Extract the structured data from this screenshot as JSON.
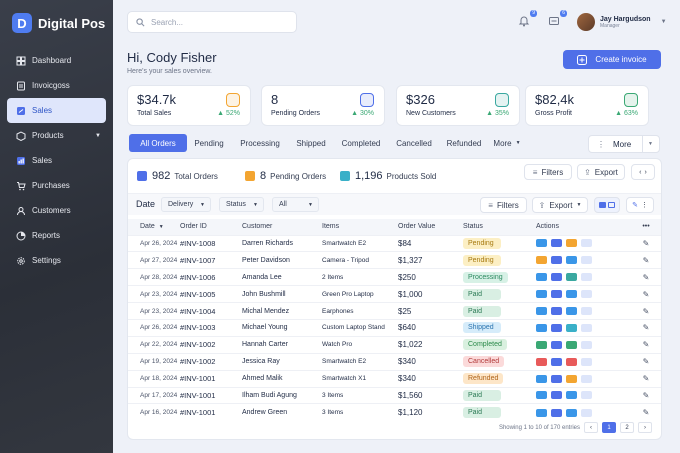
{
  "app": {
    "name": "Digital Pos",
    "logo_letter": "D"
  },
  "sidebar": {
    "items": [
      {
        "label": "Dashboard",
        "icon": "grid-icon"
      },
      {
        "label": "Invoicgoss",
        "icon": "invoice-icon"
      },
      {
        "label": "Sales",
        "icon": "sales-icon",
        "active": true
      },
      {
        "label": "Products",
        "icon": "box-icon",
        "has_caret": true
      },
      {
        "label": "Sales",
        "icon": "chart-icon"
      },
      {
        "label": "Purchases",
        "icon": "cart-icon"
      },
      {
        "label": "Customers",
        "icon": "user-icon"
      },
      {
        "label": "Reports",
        "icon": "report-icon"
      },
      {
        "label": "Settings",
        "icon": "gear-icon"
      }
    ]
  },
  "header": {
    "search_placeholder": "Search...",
    "notification_count": "9",
    "message_count": "6",
    "user_name": "Jay Hargudson",
    "user_role": "Manager"
  },
  "greeting": {
    "title": "Hi, Cody Fisher",
    "subtitle": "Here's your sales overview."
  },
  "create_button": "Create invoice",
  "stats": [
    {
      "value": "$34.7k",
      "label": "Total Sales",
      "change": "▲ 52%",
      "icon_color": "#f3a531"
    },
    {
      "value": "8",
      "label": "Pending Orders",
      "change": "▲ 30%",
      "icon_color": "#4f6fe8"
    },
    {
      "value": "$326",
      "label": "New Customers",
      "change": "▲ 35%",
      "icon_color": "#3aa8a0"
    },
    {
      "value": "$82,4k",
      "label": "Gross Profit",
      "change": "▲ 63%",
      "icon_color": "#3aa874"
    }
  ],
  "tabs": [
    "All Orders",
    "Pending",
    "Processing",
    "Shipped",
    "Completed",
    "Cancelled",
    "Refunded",
    "More"
  ],
  "more_button": "More",
  "summary": [
    {
      "count": "982",
      "label": "Total Orders",
      "color": "#4f6fe8"
    },
    {
      "count": "8",
      "label": "Pending Orders",
      "color": "#f3a531"
    },
    {
      "count": "1,196",
      "label": "Products Sold",
      "color": "#3ab0c8"
    }
  ],
  "top_buttons": {
    "filters": "Filters",
    "export": "Export"
  },
  "filter_bar": {
    "date_label": "Date",
    "delivery": "Delivery",
    "status": "Status",
    "all": "All",
    "filters": "Filters",
    "export": "Export"
  },
  "table": {
    "columns": [
      "Date",
      "Order ID",
      "Customer",
      "Items",
      "Order Value",
      "Status",
      "Actions"
    ],
    "rows": [
      {
        "date": "Apr 26, 2024",
        "id": "#INV-1008",
        "customer": "Darren Richards",
        "items": "Smartwatch E2",
        "value": "$84",
        "status": "Pending"
      },
      {
        "date": "Apr 27, 2024",
        "id": "#INV-1007",
        "customer": "Peter Davidson",
        "items": "Camera - Tripod",
        "value": "$1,327",
        "status": "Pending"
      },
      {
        "date": "Apr 28, 2024",
        "id": "#INV-1006",
        "customer": "Amanda Lee",
        "items": "2 Items",
        "value": "$250",
        "status": "Processing"
      },
      {
        "date": "Apr 23, 2024",
        "id": "#INV-1005",
        "customer": "John Bushmill",
        "items": "Green Pro Laptop",
        "value": "$1,000",
        "status": "Paid"
      },
      {
        "date": "Apr 23, 2024",
        "id": "#INV-1004",
        "customer": "Michal Mendez",
        "items": "Earphones",
        "value": "$25",
        "status": "Paid"
      },
      {
        "date": "Apr 26, 2024",
        "id": "#INV-1003",
        "customer": "Michael Young",
        "items": "Custom Laptop Stand",
        "value": "$640",
        "status": "Shipped"
      },
      {
        "date": "Apr 22, 2024",
        "id": "#INV-1002",
        "customer": "Hannah Carter",
        "items": "Watch Pro",
        "value": "$1,022",
        "status": "Completed"
      },
      {
        "date": "Apr 19, 2024",
        "id": "#INV-1002",
        "customer": "Jessica Ray",
        "items": "Smartwatch E2",
        "value": "$340",
        "status": "Cancelled"
      },
      {
        "date": "Apr 18, 2024",
        "id": "#INV-1001",
        "customer": "Ahmed Malik",
        "items": "Smartwatch X1",
        "value": "$340",
        "status": "Refunded"
      },
      {
        "date": "Apr 17, 2024",
        "id": "#INV-1001",
        "customer": "Ilham Budi Agung",
        "items": "3 Items",
        "value": "$1,560",
        "status": "Paid"
      },
      {
        "date": "Apr 16, 2024",
        "id": "#INV-1001",
        "customer": "Andrew Green",
        "items": "3 Items",
        "value": "$1,120",
        "status": "Paid"
      }
    ]
  },
  "status_colors": {
    "Pending": {
      "bg": "#fcefc4",
      "fg": "#a77a10"
    },
    "Processing": {
      "bg": "#d7f1e6",
      "fg": "#2b8a60"
    },
    "Paid": {
      "bg": "#d9efe3",
      "fg": "#2b7a55"
    },
    "Shipped": {
      "bg": "#d6ecfa",
      "fg": "#2b74b0"
    },
    "Completed": {
      "bg": "#d9f0df",
      "fg": "#2b8a4a"
    },
    "Cancelled": {
      "bg": "#fbdada",
      "fg": "#b23a3a"
    },
    "Refunded": {
      "bg": "#fde6c8",
      "fg": "#b0641a"
    }
  },
  "pagination": {
    "info": "Showing 1 to 10 of 170 entries",
    "pages": [
      "1",
      "2"
    ]
  }
}
